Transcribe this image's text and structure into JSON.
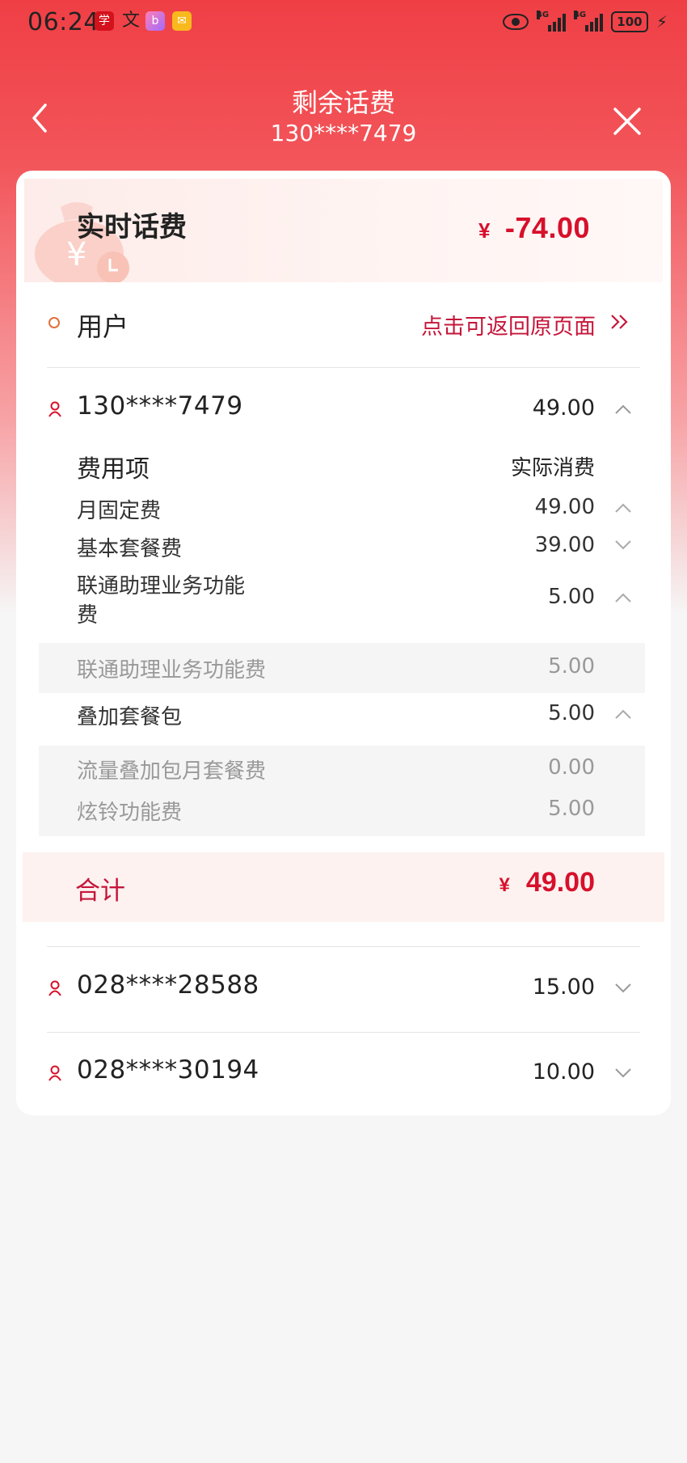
{
  "status_bar": {
    "time": "06:24",
    "network_1": "4G",
    "network_2": "4G",
    "battery": "100",
    "icons": [
      "app-icon-1",
      "translate-icon",
      "bilibili-icon",
      "message-icon",
      "eye-icon",
      "signal-icon",
      "battery-icon",
      "charging-icon"
    ]
  },
  "nav": {
    "title": "剩余话费",
    "subtitle": "130****7479"
  },
  "banner": {
    "title": "实时话费",
    "currency": "¥",
    "amount": "-74.00"
  },
  "user_row": {
    "label": "用户",
    "back_link": "点击可返回原页面"
  },
  "accounts": [
    {
      "number": "130****7479",
      "amount": "49.00",
      "expanded": true,
      "header_item": "费用项",
      "header_value": "实际消费",
      "items": [
        {
          "name": "月固定费",
          "value": "49.00",
          "expanded": true
        },
        {
          "name": "基本套餐费",
          "value": "39.00",
          "expanded": false
        },
        {
          "name_line1": "联通助理业务功能",
          "name_line2": "费",
          "value": "5.00",
          "expanded": true,
          "sub_items": [
            {
              "name": "联通助理业务功能费",
              "value": "5.00"
            }
          ]
        },
        {
          "name": "叠加套餐包",
          "value": "5.00",
          "expanded": true,
          "sub_items": [
            {
              "name": "流量叠加包月套餐费",
              "value": "0.00"
            },
            {
              "name": "炫铃功能费",
              "value": "5.00"
            }
          ]
        }
      ],
      "total_label": "合计",
      "total_currency": "¥",
      "total": "49.00"
    },
    {
      "number": "028****28588",
      "amount": "15.00",
      "expanded": false
    },
    {
      "number": "028****30194",
      "amount": "10.00",
      "expanded": false
    }
  ],
  "colors": {
    "brand_red": "#ef3f45",
    "amount_red": "#d7102b",
    "link_red": "#c5163a"
  }
}
